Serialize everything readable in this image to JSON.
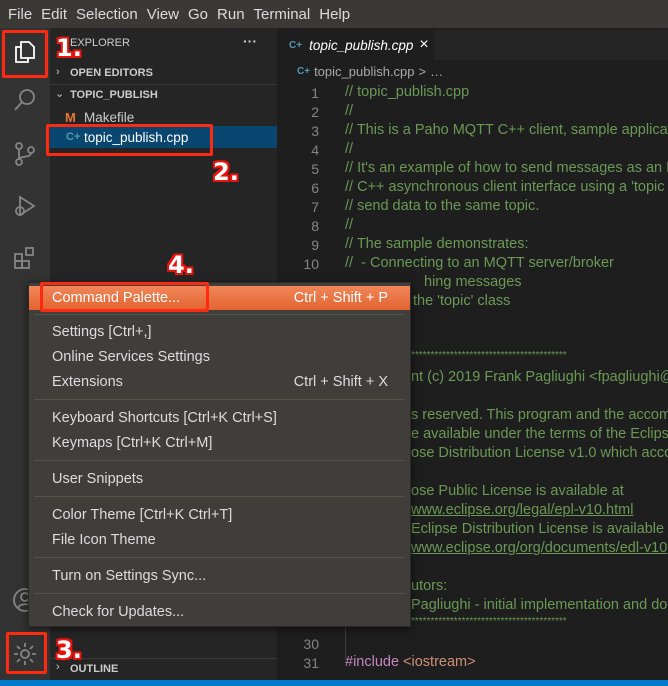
{
  "menubar": {
    "items": [
      "File",
      "Edit",
      "Selection",
      "View",
      "Go",
      "Run",
      "Terminal",
      "Help"
    ]
  },
  "activity_bar": {
    "items": [
      "explorer-icon",
      "search-icon",
      "source-control-icon",
      "run-debug-icon",
      "extensions-icon",
      "account-icon",
      "gear-icon"
    ]
  },
  "sidebar": {
    "title": "EXPLORER",
    "more": "···",
    "open_editors": "OPEN EDITORS",
    "folder": "TOPIC_PUBLISH",
    "files": [
      {
        "name": "Makefile",
        "icon": "M",
        "icon_color": "#e37933"
      },
      {
        "name": "topic_publish.cpp",
        "icon": "C+",
        "icon_color": "#519aba",
        "selected": true
      }
    ],
    "outline": "OUTLINE"
  },
  "editor": {
    "tab": {
      "label": "topic_publish.cpp",
      "close": "×"
    },
    "breadcrumb": {
      "file": "topic_publish.cpp",
      "sep": ">",
      "rest": "…"
    },
    "line_numbers": [
      "1",
      "2",
      "3",
      "4",
      "5",
      "6",
      "7",
      "8",
      "9",
      "10",
      "30",
      "31"
    ],
    "lines": {
      "l1": "// topic_publish.cpp",
      "l2": "//",
      "l3": "// This is a Paho MQTT C++ client, sample applicati",
      "l4": "//",
      "l5": "// It's an example of how to send messages as an M",
      "l6": "// C++ asynchronous client interface using a 'topic",
      "l7": "// send data to the same topic.",
      "l8": "//",
      "l9": "// The sample demonstrates:",
      "l10": "//  - Connecting to an MQTT server/broker",
      "l11": "hing messages",
      "l12": "the 'topic' class",
      "l15": "****************************************",
      "l16": "nt (c) 2019 Frank Pagliughi <fpagliughi@",
      "l18": "s reserved. This program and the accom",
      "l19": "e available under the terms of the Eclips",
      "l20": "ose Distribution License v1.0 which acco",
      "l22": "ose Public License is available at",
      "l23": "www.eclipse.org/legal/epl-v10.html",
      "l24": "Eclipse Distribution License is available",
      "l25": "www.eclipse.org/org/documents/edl-v10",
      "l27": "utors:",
      "l28": "Pagliughi - initial implementation and do",
      "l29": "****************************************",
      "l31_kw": "#include",
      "l31_arg": "<iostream>"
    }
  },
  "context_menu": {
    "items": [
      {
        "label": "Command Palette...",
        "shortcut": "Ctrl + Shift + P",
        "highlighted": true
      },
      {
        "label": "Settings [Ctrl+,]",
        "shortcut": ""
      },
      {
        "label": "Online Services Settings",
        "shortcut": ""
      },
      {
        "label": "Extensions",
        "shortcut": "Ctrl + Shift + X"
      },
      {
        "label": "Keyboard Shortcuts [Ctrl+K Ctrl+S]",
        "shortcut": ""
      },
      {
        "label": "Keymaps [Ctrl+K Ctrl+M]",
        "shortcut": ""
      },
      {
        "label": "User Snippets",
        "shortcut": ""
      },
      {
        "label": "Color Theme [Ctrl+K Ctrl+T]",
        "shortcut": ""
      },
      {
        "label": "File Icon Theme",
        "shortcut": ""
      },
      {
        "label": "Turn on Settings Sync...",
        "shortcut": ""
      },
      {
        "label": "Check for Updates...",
        "shortcut": ""
      }
    ]
  },
  "annotations": {
    "step1": "1.",
    "step2": "2.",
    "step3": "3.",
    "step4": "4.",
    "color": "#ff2a12"
  },
  "colors": {
    "accent": "#007acc",
    "highlight": "#e9663a",
    "comment": "#6a9955"
  }
}
